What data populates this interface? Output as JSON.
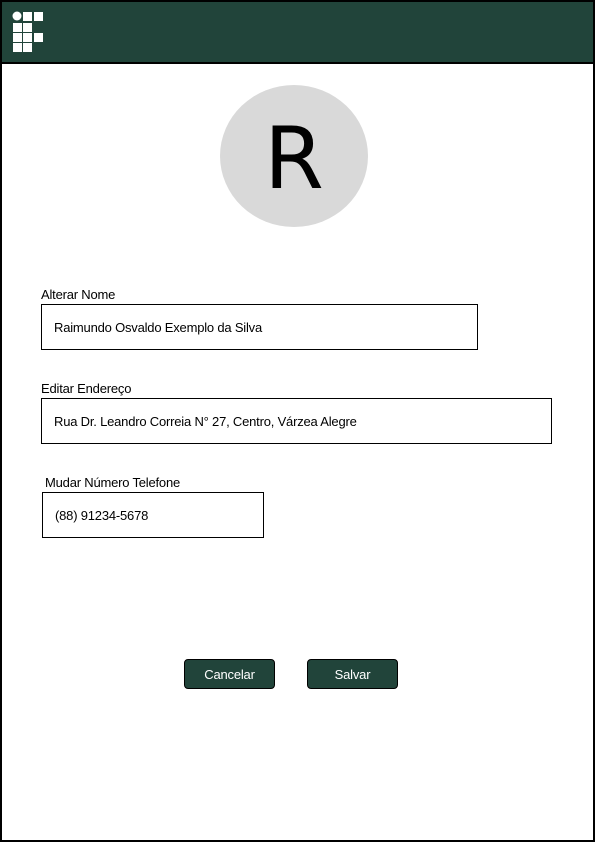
{
  "header": {
    "logo_icon": "institution-grid-logo",
    "background_color": "#21443a"
  },
  "profile": {
    "avatar_letter": "R",
    "avatar_color": "#d9d9d9"
  },
  "form": {
    "name": {
      "label": "Alterar Nome",
      "value": "Raimundo Osvaldo Exemplo da Silva"
    },
    "address": {
      "label": "Editar Endereço",
      "value": "Rua Dr. Leandro Correia N° 27, Centro, Várzea Alegre"
    },
    "phone": {
      "label": "Mudar Número Telefone",
      "value": "(88) 91234-5678"
    }
  },
  "actions": {
    "cancel_label": "Cancelar",
    "save_label": "Salvar",
    "button_color": "#21443a"
  }
}
